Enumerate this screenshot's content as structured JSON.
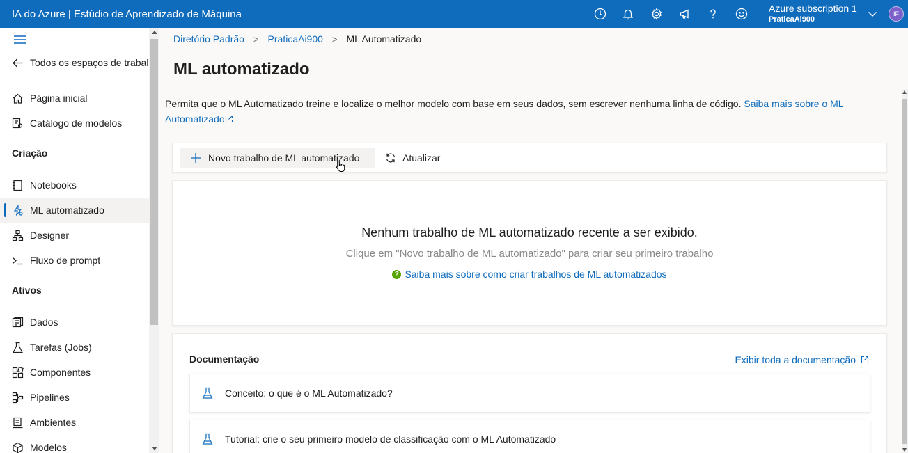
{
  "header": {
    "app_title": "IA do Azure | Estúdio de Aprendizado de Máquina",
    "icons": [
      "clock-icon",
      "bell-icon",
      "gear-icon",
      "megaphone-icon",
      "help-icon",
      "smiley-icon"
    ],
    "subscription_name": "Azure subscription 1",
    "workspace_name": "PraticaAi900",
    "avatar_initials": "IF",
    "colors": {
      "bar": "#0f6cbd",
      "avatar": "#7b61c9"
    }
  },
  "sidebar": {
    "back_label": "Todos os espaços de trabalho",
    "top_items": [
      {
        "label": "Página inicial",
        "icon": "home-icon"
      },
      {
        "label": "Catálogo de modelos",
        "icon": "catalog-icon"
      }
    ],
    "section_creation": "Criação",
    "creation_items": [
      {
        "label": "Notebooks",
        "icon": "notebook-icon"
      },
      {
        "label": "ML automatizado",
        "icon": "automl-icon",
        "active": true
      },
      {
        "label": "Designer",
        "icon": "designer-icon"
      },
      {
        "label": "Fluxo de prompt",
        "icon": "prompt-flow-icon"
      }
    ],
    "section_assets": "Ativos",
    "asset_items": [
      {
        "label": "Dados",
        "icon": "data-icon"
      },
      {
        "label": "Tarefas (Jobs)",
        "icon": "flask-icon"
      },
      {
        "label": "Componentes",
        "icon": "components-icon"
      },
      {
        "label": "Pipelines",
        "icon": "pipelines-icon"
      },
      {
        "label": "Ambientes",
        "icon": "environments-icon"
      },
      {
        "label": "Modelos",
        "icon": "models-icon"
      }
    ]
  },
  "breadcrumb": {
    "items": [
      "Diretório Padrão",
      "PraticaAi900",
      "ML Automatizado"
    ],
    "separator": ">"
  },
  "page": {
    "title": "ML automatizado",
    "description": "Permita que o ML Automatizado treine e localize o melhor modelo com base em seus dados, sem escrever nenhuma linha de código.",
    "learn_more_link": "Saiba mais sobre o ML Automatizado"
  },
  "toolbar": {
    "new_job_label": "Novo trabalho de ML automatizado",
    "refresh_label": "Atualizar"
  },
  "empty_state": {
    "title": "Nenhum trabalho de ML automatizado recente a ser exibido.",
    "subtitle": "Clique em \"Novo trabalho de ML automatizado\" para criar seu primeiro trabalho",
    "help_link": "Saiba mais sobre como criar trabalhos de ML automatizados",
    "help_icon_text": "?"
  },
  "documentation": {
    "title": "Documentação",
    "view_all_link": "Exibir toda a documentação",
    "cards": [
      "Conceito: o que é o ML Automatizado?",
      "Tutorial: crie o seu primeiro modelo de classificação com o ML Automatizado"
    ]
  }
}
